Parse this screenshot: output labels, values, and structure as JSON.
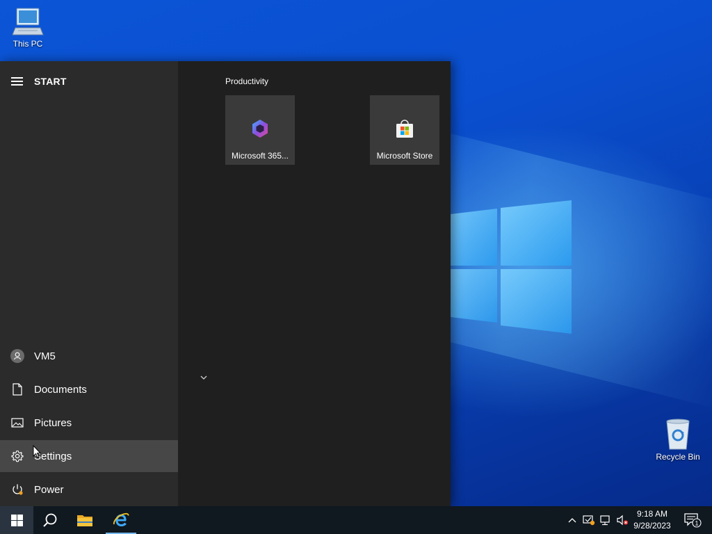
{
  "desktop": {
    "icons": [
      {
        "label": "This PC",
        "icon": "monitor-icon"
      },
      {
        "label": "Recycle Bin",
        "icon": "recycle-bin-icon"
      }
    ]
  },
  "start_menu": {
    "title": "START",
    "rail": [
      {
        "label": "VM5",
        "icon": "user-avatar-icon"
      },
      {
        "label": "Documents",
        "icon": "document-icon"
      },
      {
        "label": "Pictures",
        "icon": "picture-icon"
      },
      {
        "label": "Settings",
        "icon": "gear-icon"
      },
      {
        "label": "Power",
        "icon": "power-icon"
      }
    ],
    "group": "Productivity",
    "tiles": [
      {
        "label": "Microsoft 365...",
        "icon": "microsoft-365-icon"
      },
      {
        "label": "Microsoft Store",
        "icon": "store-bag-icon"
      }
    ]
  },
  "taskbar": {
    "time": "9:18 AM",
    "date": "9/28/2023",
    "notification_count": "1",
    "colors": {
      "taskbar": "#101820",
      "accent": "#76b9ed",
      "rail_bg": "#2b2b2b",
      "tiles_bg": "#1f1f1f"
    }
  }
}
